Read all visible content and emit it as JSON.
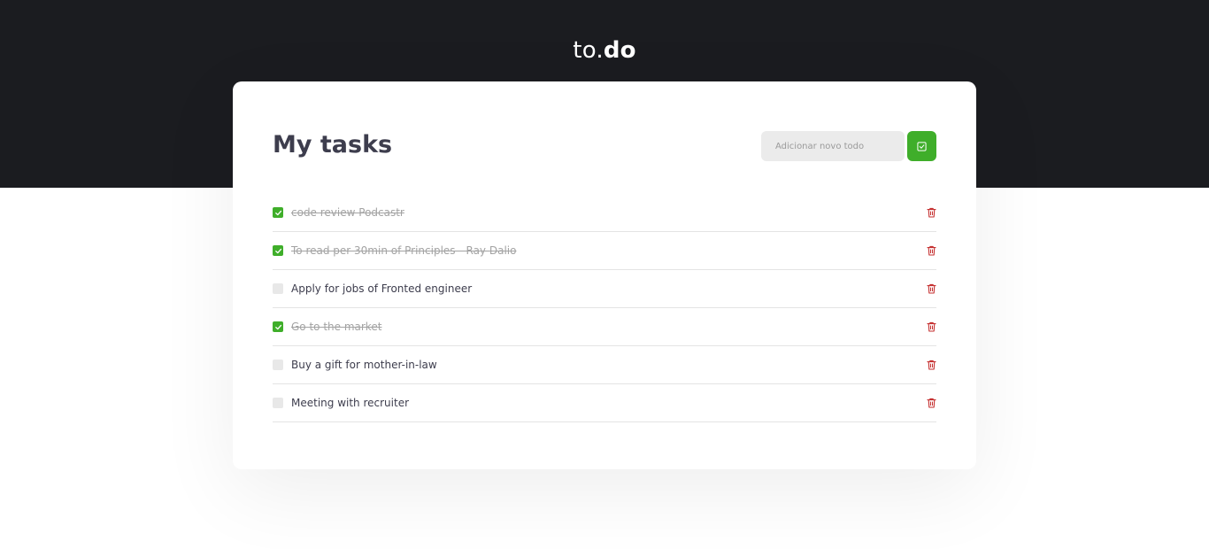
{
  "header": {
    "logo_light": "to.",
    "logo_bold": "do"
  },
  "card": {
    "title": "My tasks",
    "add_input_placeholder": "Adicionar novo todo",
    "add_button_icon": "check-square-icon"
  },
  "tasks": [
    {
      "text": "code review Podcastr",
      "done": true
    },
    {
      "text": "To read per 30min of Principles - Ray Dalio",
      "done": true
    },
    {
      "text": "Apply for jobs of Fronted engineer",
      "done": false
    },
    {
      "text": "Go to the market",
      "done": true
    },
    {
      "text": "Buy a gift for mother-in-law",
      "done": false
    },
    {
      "text": "Meeting with recruiter",
      "done": false
    }
  ],
  "colors": {
    "header_background": "#1b1c20",
    "accent_green": "#3fae2a",
    "delete_red": "#c53030",
    "title_text": "#3d3d4d"
  }
}
